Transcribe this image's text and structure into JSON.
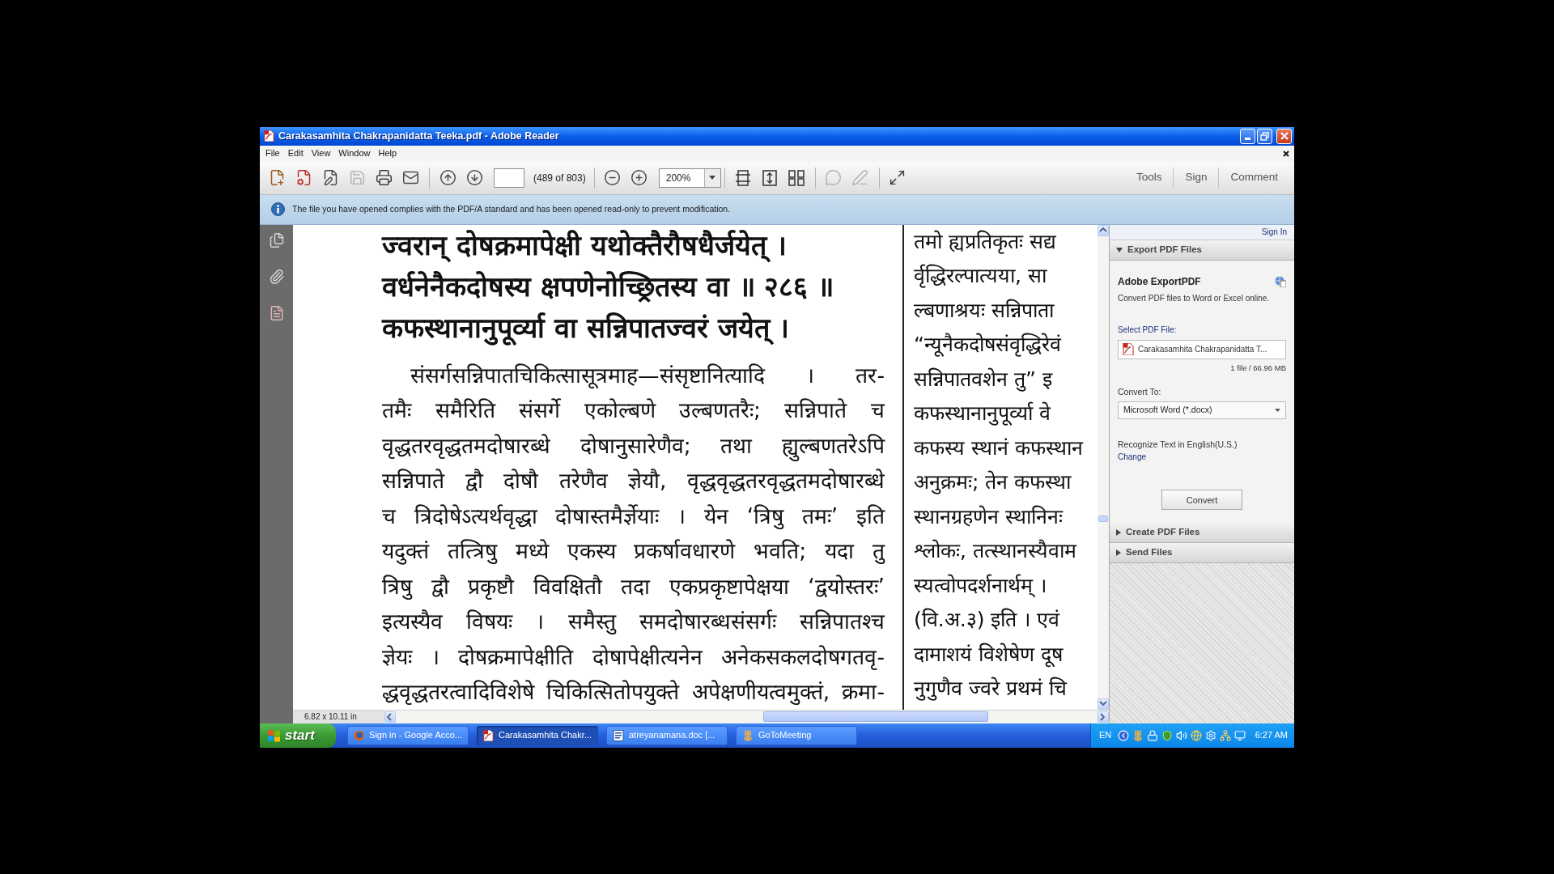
{
  "window": {
    "title": "Carakasamhita Chakrapanidatta Teeka.pdf - Adobe Reader"
  },
  "menu": [
    "File",
    "Edit",
    "View",
    "Window",
    "Help"
  ],
  "toolbar": {
    "groups": [
      [
        {
          "kind": "create",
          "disabled": false
        },
        {
          "kind": "export",
          "disabled": false
        },
        {
          "kind": "edit",
          "disabled": false
        },
        {
          "kind": "save",
          "disabled": true
        },
        {
          "kind": "print",
          "disabled": false
        },
        {
          "kind": "email",
          "disabled": false
        }
      ],
      [
        {
          "kind": "previous",
          "disabled": false
        },
        {
          "kind": "next",
          "disabled": false
        },
        {
          "kind": "page_field",
          "disabled": false
        },
        {
          "kind": "page_count",
          "text": "(489 of 803)",
          "disabled": false
        }
      ],
      [
        {
          "kind": "zoom_out",
          "disabled": false
        },
        {
          "kind": "zoom_in",
          "disabled": false
        },
        {
          "kind": "zoom",
          "value": "200%",
          "disabled": false
        }
      ],
      [
        {
          "kind": "scroll_mode",
          "disabled": false
        },
        {
          "kind": "fit_page",
          "disabled": false
        },
        {
          "kind": "two_page",
          "disabled": false
        }
      ],
      [
        {
          "kind": "comment",
          "disabled": true
        },
        {
          "kind": "sign",
          "disabled": true
        }
      ],
      [
        {
          "kind": "full_screen",
          "disabled": false
        }
      ]
    ],
    "tabs": [
      "Tools",
      "Sign",
      "Comment"
    ]
  },
  "info_bar": {
    "message": "The file you have opened complies with the PDF/A standard and has been opened read-only to prevent modification."
  },
  "document": {
    "verses": [
      "ज्वरान् दोषक्रमापेक्षी यथोक्तैरौषधैर्जयेत् ।",
      "वर्धनेनैकदोषस्य क्षपणेनोच्छ्रितस्य वा ॥ २८६ ॥",
      "कफस्थानानुपूर्व्या वा सन्निपातज्वरं जयेत् ।"
    ],
    "commentary": [
      "संसर्गसन्निपातचिकित्सासूत्रमाह—संसृष्टानित्यादि । तर-",
      "तमैः समैरिति संसर्गे एकोल्बणे उल्बणतरैः; सन्निपाते च",
      "वृद्धतरवृद्धतमदोषारब्धे दोषानुसारेणैव; तथा ह्युल्बणतरेऽपि",
      "सन्निपाते द्वौ दोषौ तरेणैव ज्ञेयौ, वृद्धवृद्धतरवृद्धतमदोषारब्धे",
      "च त्रिदोषेऽत्यर्थवृद्धा दोषास्तमैर्ज्ञेयाः । येन ‘त्रिषु तमः’ इति",
      "यदुक्तं तत्त्रिषु मध्ये एकस्य प्रकर्षावधारणे भवति; यदा तु",
      "त्रिषु द्वौ प्रकृष्टौ विवक्षितौ तदा एकप्रकृष्टापेक्षया ‘द्वयोस्तरः’",
      "इत्यस्यैव विषयः । समैस्तु समदोषारब्धसंसर्गः सन्निपातश्च",
      "ज्ञेयः । दोषक्रमापेक्षीति दोषापेक्षीत्यनेन अनेकसकलदोषगतवृ-",
      "द्धवृद्धतरत्वादिविशेषे चिकित्सितोपयुक्ते अपेक्षणीयत्वमुक्तं, क्रमा-"
    ],
    "right_column": [
      "तमो ह्यप्रतिकृतः सद्य",
      "र्वृद्धिरल्पात्यया, सा",
      "ल्बणाश्रयः सन्निपाता",
      "“न्यूनैकदोषसंवृद्धिरेवं",
      "सन्निपातवशेन तु” इ",
      "कफस्थानानुपूर्व्या वे",
      "कफस्य स्थानं कफस्थान",
      "अनुक्रमः; तेन कफस्था",
      "स्थानग्रहणेन स्थानिनः",
      "श्लोकः, तत्स्थानस्यैवाम",
      "स्यत्वोपदर्शनार्थम् ।",
      "(वि.अ.३) इति । एवं",
      "दामाशयं विशेषेण दूष",
      "नुगुणैव ज्वरे प्रथमं चि"
    ]
  },
  "status": {
    "page_size": "6.82 x 10.11 in"
  },
  "side_panel": {
    "sign_in": "Sign In",
    "sections": [
      {
        "title": "Export PDF Files",
        "expanded": true,
        "content": {
          "heading": "Adobe ExportPDF",
          "description": "Convert PDF files to Word or Excel online.",
          "file_label": "Select PDF File:",
          "file": "Carakasamhita Chakrapanidatta T...",
          "file_size": "1 file / 66.96 MB",
          "convert_label": "Convert To:",
          "format": "Microsoft Word (*.docx)",
          "ocr_text": "Recognize Text in English(U.S.)",
          "change_link": "Change",
          "button": "Convert"
        }
      },
      {
        "title": "Create PDF Files",
        "expanded": false
      },
      {
        "title": "Send Files",
        "expanded": false
      }
    ]
  },
  "taskbar": {
    "start": "start",
    "tasks": [
      {
        "label": "Sign in - Google Acco...",
        "kind": "browser",
        "selected": false
      },
      {
        "label": "Carakasamhita Chakr...",
        "kind": "pdf",
        "selected": true
      },
      {
        "label": "atreyanamana.doc [...",
        "kind": "document",
        "selected": false
      },
      {
        "label": "GoToMeeting",
        "kind": "meeting",
        "selected": false
      }
    ],
    "tray": {
      "language": "EN",
      "time": "6:27 AM"
    }
  }
}
